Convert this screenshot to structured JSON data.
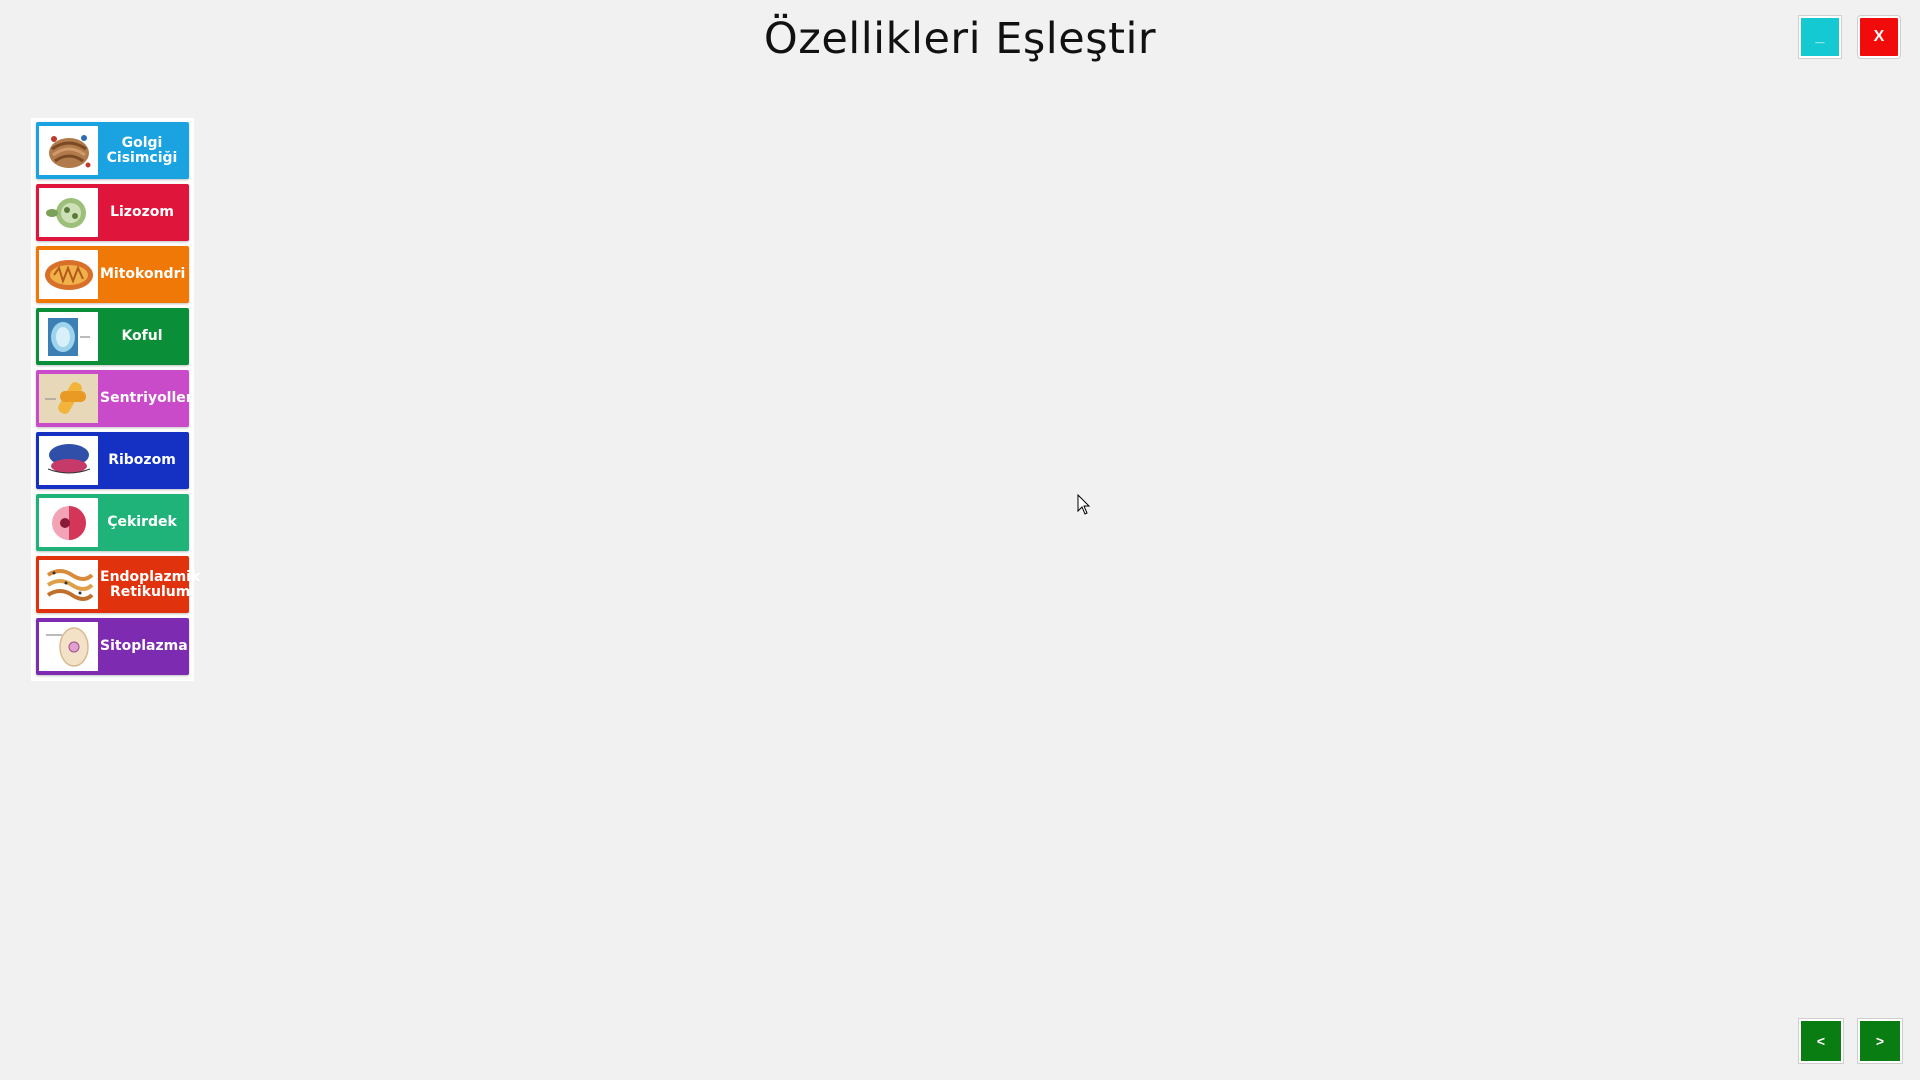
{
  "header": {
    "title": "Özellikleri Eşleştir",
    "minimize_label": "_",
    "close_label": "X"
  },
  "organelles": [
    {
      "label": "Golgi\nCisimciği",
      "color": "#1aa3e0",
      "icon": "golgi-image"
    },
    {
      "label": "Lizozom",
      "color": "#e0153c",
      "icon": "lysosome-image"
    },
    {
      "label": "Mitokondri",
      "color": "#f07806",
      "icon": "mitochondria-image"
    },
    {
      "label": "Koful",
      "color": "#0b8e38",
      "icon": "vacuole-image"
    },
    {
      "label": "Sentriyoller",
      "color": "#c94bc9",
      "icon": "centriole-image"
    },
    {
      "label": "Ribozom",
      "color": "#1531c4",
      "icon": "ribosome-image"
    },
    {
      "label": "Çekirdek",
      "color": "#1fb37a",
      "icon": "nucleus-image"
    },
    {
      "label": "Endoplazmik\nRetikulum",
      "color": "#e0320d",
      "icon": "er-image"
    },
    {
      "label": "Sitoplazma",
      "color": "#7d2bb0",
      "icon": "cytoplasm-image"
    }
  ],
  "navigation": {
    "prev_label": "<",
    "next_label": ">"
  }
}
